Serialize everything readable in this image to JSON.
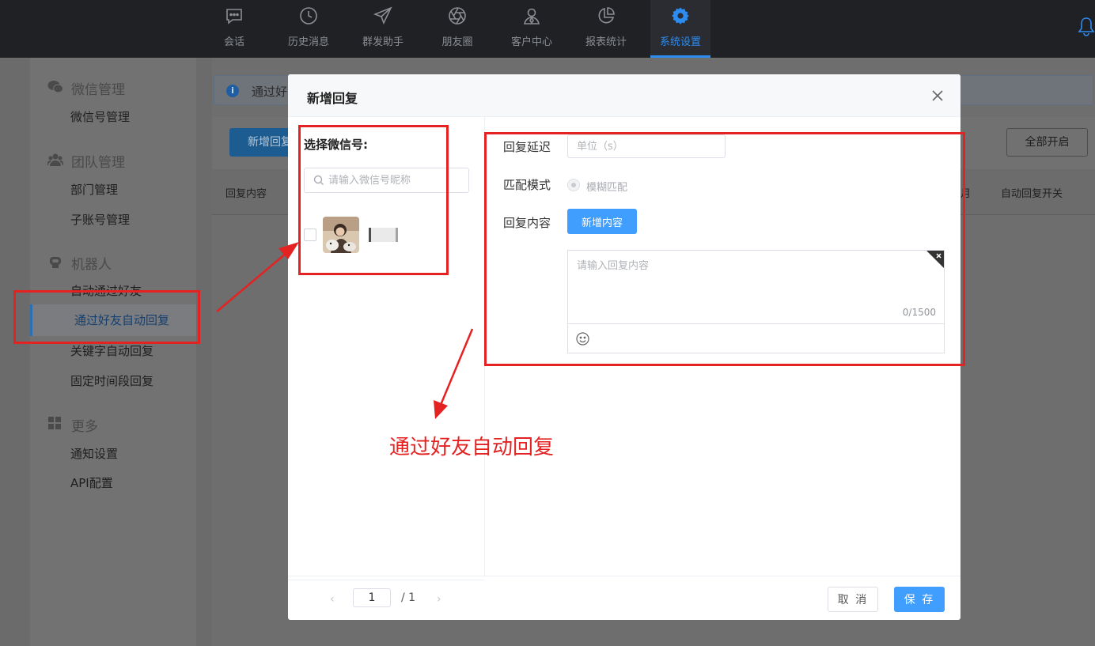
{
  "nav": {
    "items": [
      {
        "label": "会话",
        "icon": "chat-icon"
      },
      {
        "label": "历史消息",
        "icon": "clock-icon"
      },
      {
        "label": "群发助手",
        "icon": "paper-plane-icon"
      },
      {
        "label": "朋友圈",
        "icon": "aperture-icon"
      },
      {
        "label": "客户中心",
        "icon": "user-icon"
      },
      {
        "label": "报表统计",
        "icon": "pie-chart-icon"
      },
      {
        "label": "系统设置",
        "icon": "gear-icon",
        "active": true
      }
    ]
  },
  "sidebar": {
    "groups": [
      {
        "label": "微信管理",
        "icon": "wechat-icon",
        "items": [
          "微信号管理"
        ]
      },
      {
        "label": "团队管理",
        "icon": "team-icon",
        "items": [
          "部门管理",
          "子账号管理"
        ]
      },
      {
        "label": "机器人",
        "icon": "robot-icon",
        "items": [
          "自动通过好友",
          "通过好友自动回复",
          "关键字自动回复",
          "固定时间段回复"
        ]
      },
      {
        "label": "更多",
        "icon": "grid-icon",
        "items": [
          "通知设置",
          "API配置"
        ]
      }
    ],
    "active_item": "通过好友自动回复"
  },
  "background": {
    "info_text": "通过好",
    "new_button": "新增回复",
    "enable_all_button": "全部开启",
    "columns": [
      "回复内容",
      "自动回复开关"
    ],
    "column_fragment": "月"
  },
  "modal": {
    "title": "新增回复",
    "select_account_title": "选择微信号:",
    "search_placeholder": "请输入微信号昵称",
    "pager": {
      "current": "1",
      "total": "/ 1"
    },
    "form": {
      "delay_label": "回复延迟",
      "delay_placeholder": "单位（s）",
      "match_label": "匹配模式",
      "match_option": "模糊匹配",
      "content_label": "回复内容",
      "add_content_button": "新增内容",
      "content_placeholder": "请输入回复内容",
      "char_count": "0/1500"
    },
    "cancel_button": "取 消",
    "save_button": "保 存"
  },
  "annotation": {
    "text": "通过好友自动回复",
    "color": "#e52222"
  },
  "colors": {
    "primary": "#409eff",
    "nav_active": "#2d8cf0",
    "topbar": "#1f2125"
  }
}
